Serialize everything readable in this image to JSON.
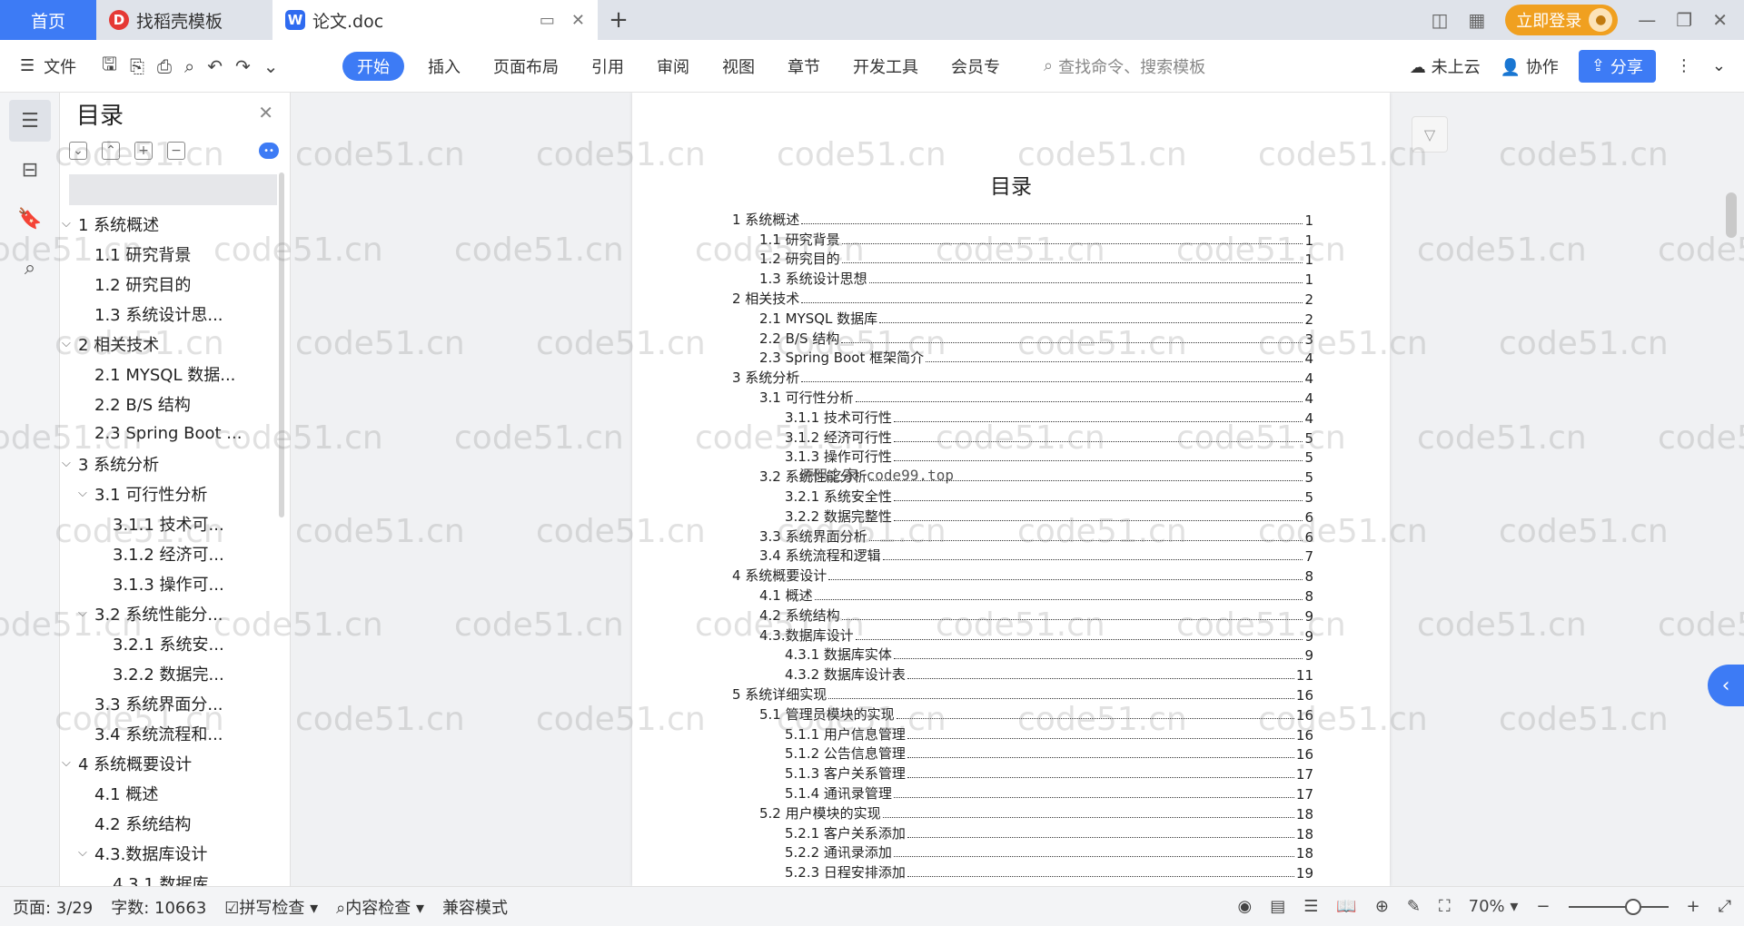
{
  "titlebar": {
    "home_tab": "首页",
    "tabs": [
      {
        "label": "找稻壳模板",
        "icon": "docer-icon"
      },
      {
        "label": "论文.doc",
        "icon": "wps-writer-icon"
      }
    ],
    "login_label": "立即登录"
  },
  "ribbon": {
    "file_label": "文件",
    "tabs": [
      "开始",
      "插入",
      "页面布局",
      "引用",
      "审阅",
      "视图",
      "章节",
      "开发工具",
      "会员专"
    ],
    "active_tab": "开始",
    "search_placeholder": "查找命令、搜索模板",
    "cloud_label": "未上云",
    "collab_label": "协作",
    "share_label": "分享"
  },
  "toc_panel": {
    "title": "目录",
    "items": [
      {
        "label": "1 系统概述",
        "level": 1,
        "expanded": true
      },
      {
        "label": "1.1 研究背景",
        "level": 2
      },
      {
        "label": "1.2 研究目的",
        "level": 2
      },
      {
        "label": "1.3 系统设计思...",
        "level": 2
      },
      {
        "label": "2 相关技术",
        "level": 1,
        "expanded": true
      },
      {
        "label": "2.1 MYSQL 数据...",
        "level": 2
      },
      {
        "label": "2.2 B/S 结构",
        "level": 2
      },
      {
        "label": "2.3 Spring Boot ...",
        "level": 2
      },
      {
        "label": "3 系统分析",
        "level": 1,
        "expanded": true
      },
      {
        "label": "3.1 可行性分析",
        "level": 2,
        "expanded": true
      },
      {
        "label": "3.1.1 技术可...",
        "level": 3
      },
      {
        "label": "3.1.2 经济可...",
        "level": 3
      },
      {
        "label": "3.1.3 操作可...",
        "level": 3
      },
      {
        "label": "3.2 系统性能分...",
        "level": 2,
        "expanded": true
      },
      {
        "label": "3.2.1 系统安...",
        "level": 3
      },
      {
        "label": "3.2.2 数据完...",
        "level": 3
      },
      {
        "label": "3.3 系统界面分...",
        "level": 2
      },
      {
        "label": "3.4 系统流程和...",
        "level": 2
      },
      {
        "label": "4 系统概要设计",
        "level": 1,
        "expanded": true
      },
      {
        "label": "4.1 概述",
        "level": 2
      },
      {
        "label": "4.2 系统结构",
        "level": 2
      },
      {
        "label": "4.3.数据库设计",
        "level": 2,
        "expanded": true
      },
      {
        "label": "4.3.1 数据库...",
        "level": 3
      }
    ]
  },
  "document": {
    "title": "目录",
    "toc": [
      {
        "text": "1 系统概述",
        "page": "1",
        "level": 1
      },
      {
        "text": "1.1 研究背景",
        "page": "1",
        "level": 2
      },
      {
        "text": "1.2 研究目的",
        "page": "1",
        "level": 2
      },
      {
        "text": "1.3 系统设计思想",
        "page": "1",
        "level": 2
      },
      {
        "text": "2 相关技术",
        "page": "2",
        "level": 1
      },
      {
        "text": "2.1 MYSQL 数据库",
        "page": "2",
        "level": 2
      },
      {
        "text": "2.2 B/S 结构",
        "page": "3",
        "level": 2
      },
      {
        "text": "2.3 Spring Boot 框架简介",
        "page": "4",
        "level": 2
      },
      {
        "text": "3 系统分析",
        "page": "4",
        "level": 1
      },
      {
        "text": "3.1 可行性分析",
        "page": "4",
        "level": 2
      },
      {
        "text": "3.1.1 技术可行性",
        "page": "4",
        "level": 3
      },
      {
        "text": "3.1.2 经济可行性",
        "page": "5",
        "level": 3
      },
      {
        "text": "3.1.3 操作可行性",
        "page": "5",
        "level": 3
      },
      {
        "text": "3.2 系统性能分析",
        "page": "5",
        "level": 2
      },
      {
        "text": "3.2.1 系统安全性",
        "page": "5",
        "level": 3
      },
      {
        "text": "3.2.2 数据完整性",
        "page": "6",
        "level": 3
      },
      {
        "text": "3.3 系统界面分析",
        "page": "6",
        "level": 2
      },
      {
        "text": "3.4 系统流程和逻辑",
        "page": "7",
        "level": 2
      },
      {
        "text": "4 系统概要设计",
        "page": "8",
        "level": 1
      },
      {
        "text": "4.1 概述",
        "page": "8",
        "level": 2
      },
      {
        "text": "4.2 系统结构",
        "page": "9",
        "level": 2
      },
      {
        "text": "4.3.数据库设计",
        "page": "9",
        "level": 2
      },
      {
        "text": "4.3.1 数据库实体",
        "page": "9",
        "level": 3
      },
      {
        "text": "4.3.2 数据库设计表",
        "page": "11",
        "level": 3
      },
      {
        "text": "5 系统详细实现",
        "page": "16",
        "level": 1
      },
      {
        "text": "5.1 管理员模块的实现",
        "page": "16",
        "level": 2
      },
      {
        "text": "5.1.1 用户信息管理",
        "page": "16",
        "level": 3
      },
      {
        "text": "5.1.2 公告信息管理",
        "page": "16",
        "level": 3
      },
      {
        "text": "5.1.3 客户关系管理",
        "page": "17",
        "level": 3
      },
      {
        "text": "5.1.4 通讯录管理",
        "page": "17",
        "level": 3
      },
      {
        "text": "5.2 用户模块的实现",
        "page": "18",
        "level": 2
      },
      {
        "text": "5.2.1 客户关系添加",
        "page": "18",
        "level": 3
      },
      {
        "text": "5.2.2 通讯录添加",
        "page": "18",
        "level": 3
      },
      {
        "text": "5.2.3 日程安排添加",
        "page": "19",
        "level": 3
      }
    ],
    "overlay_text": "源码之家 code99.top"
  },
  "watermark": "code51.cn",
  "status": {
    "page": "页面: 3/29",
    "words": "字数: 10663",
    "spell_check": "拼写检查",
    "content_check": "内容检查",
    "compat_mode": "兼容模式",
    "zoom": "70%"
  }
}
